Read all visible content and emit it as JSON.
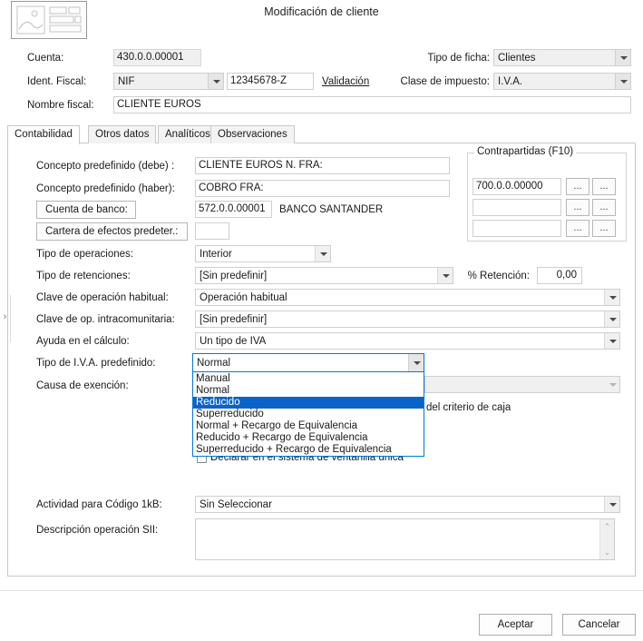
{
  "dialog": {
    "title": "Modificación de cliente",
    "icon": "form-image-placeholder-icon"
  },
  "header": {
    "cuenta_label": "Cuenta:",
    "cuenta_value": "430.0.0.00001",
    "ident_fiscal_label": "Ident. Fiscal:",
    "ident_fiscal_type": "NIF",
    "ident_fiscal_value": "12345678-Z",
    "validacion_link": "Validación",
    "nombre_fiscal_label": "Nombre fiscal:",
    "nombre_fiscal_value": "CLIENTE EUROS",
    "tipo_ficha_label": "Tipo de ficha:",
    "tipo_ficha_value": "Clientes",
    "clase_impuesto_label": "Clase de impuesto:",
    "clase_impuesto_value": "I.V.A."
  },
  "tabs": [
    {
      "label": "Contabilidad",
      "active": true
    },
    {
      "label": "Otros datos",
      "active": false
    },
    {
      "label": "Analíticos",
      "active": false
    },
    {
      "label": "Observaciones",
      "active": false
    }
  ],
  "form": {
    "concepto_debe_label": "Concepto predefinido (debe) :",
    "concepto_debe_value": "CLIENTE EUROS N. FRA:",
    "concepto_haber_label": "Concepto predefinido (haber):",
    "concepto_haber_value": "COBRO FRA:",
    "cuenta_banco_label": "Cuenta de banco:",
    "cuenta_banco_value": "572.0.0.00001",
    "cuenta_banco_desc": "BANCO SANTANDER",
    "cartera_efectos_label": "Cartera de efectos predeter.:",
    "cartera_efectos_value": "",
    "tipo_operaciones_label": "Tipo de operaciones:",
    "tipo_operaciones_value": "Interior",
    "tipo_retenciones_label": "Tipo de retenciones:",
    "tipo_retenciones_value": "[Sin predefinir]",
    "pct_retencion_label": "% Retención:",
    "pct_retencion_value": "0,00",
    "clave_operacion_label": "Clave de operación habitual:",
    "clave_operacion_value": "Operación habitual",
    "clave_intracom_label": "Clave de op. intracomunitaria:",
    "clave_intracom_value": "[Sin predefinir]",
    "ayuda_calculo_label": "Ayuda en el cálculo:",
    "ayuda_calculo_value": "Un tipo de IVA",
    "tipo_iva_label": "Tipo de I.V.A. predefinido:",
    "tipo_iva_value": "Normal",
    "causa_exencion_label": "Causa de exención:",
    "causa_exencion_value": "",
    "criterio_caja_text": "del criterio de caja",
    "ventanilla_unica_text": "Declarar en el sistema de ventanilla única",
    "actividad_1kb_label": "Actividad para Código 1kB:",
    "actividad_1kb_value": "Sin Seleccionar",
    "descripcion_sii_label": "Descripción operación SII:",
    "descripcion_sii_value": ""
  },
  "contrapartidas": {
    "legend": "Contrapartidas (F10)",
    "rows": [
      {
        "value": "700.0.0.00000",
        "btn1": "...",
        "btn2": "..."
      },
      {
        "value": "",
        "btn1": "...",
        "btn2": "..."
      },
      {
        "value": "",
        "btn1": "...",
        "btn2": "..."
      }
    ]
  },
  "iva_dropdown": {
    "open": true,
    "selected": "Reducido",
    "options": [
      "Manual",
      "Normal",
      "Reducido",
      "Superreducido",
      "Normal + Recargo de Equivalencia",
      "Reducido + Recargo de Equivalencia",
      "Superreducido + Recargo de Equivalencia"
    ]
  },
  "footer": {
    "accept_label": "Aceptar",
    "cancel_label": "Cancelar"
  },
  "colors": {
    "selection_blue": "#0a64c8",
    "focus_border": "#0078d7",
    "field_grey": "#f0f0f0",
    "window_bg": "#ffffff"
  },
  "icons": {
    "expander": "›",
    "scroll_up": "⌃",
    "scroll_down": "⌄"
  }
}
